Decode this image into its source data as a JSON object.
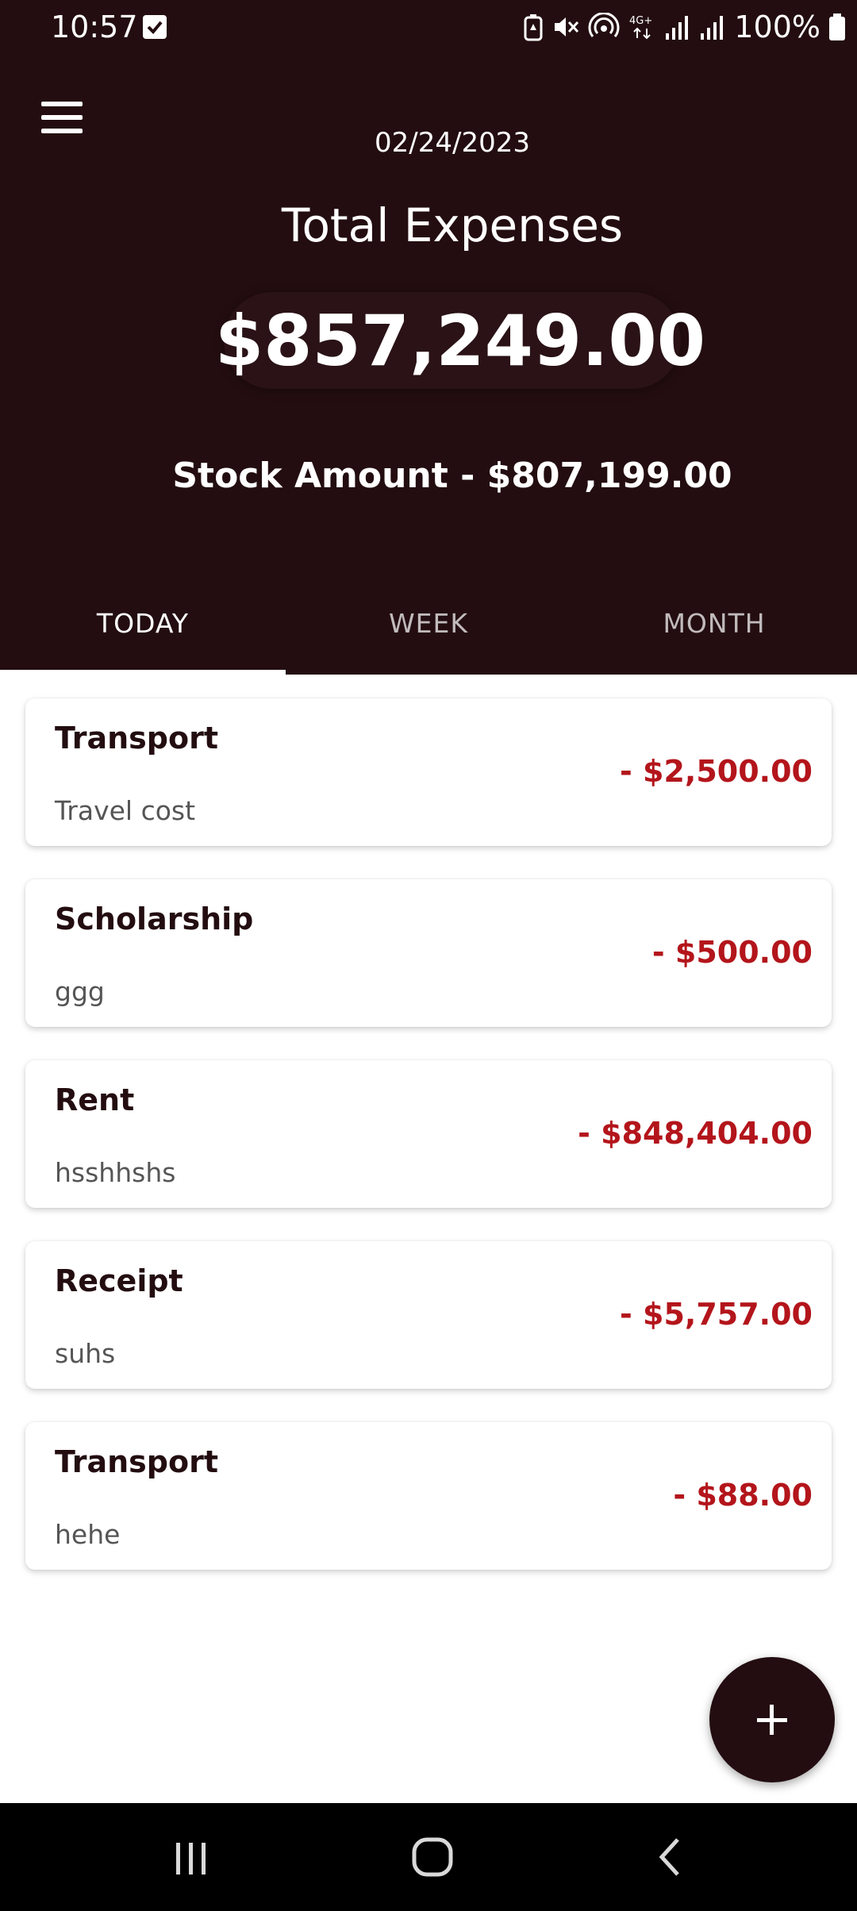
{
  "status_bar": {
    "time": "10:57",
    "battery": "100%",
    "network": "4G+"
  },
  "header": {
    "date": "02/24/2023",
    "title": "Total Expenses",
    "total_amount": "$857,249.00",
    "stock_amount": "Stock Amount - $807,199.00",
    "background_color": "#230d10"
  },
  "tabs": [
    {
      "label": "TODAY",
      "active": true
    },
    {
      "label": "WEEK",
      "active": false
    },
    {
      "label": "MONTH",
      "active": false
    }
  ],
  "expenses": [
    {
      "category": "Transport",
      "description": "Travel cost",
      "amount": "- $2,500.00"
    },
    {
      "category": "Scholarship",
      "description": "ggg",
      "amount": "- $500.00"
    },
    {
      "category": "Rent",
      "description": "hsshhshs",
      "amount": "- $848,404.00"
    },
    {
      "category": "Receipt",
      "description": "suhs",
      "amount": "- $5,757.00"
    },
    {
      "category": "Transport",
      "description": "hehe",
      "amount": "- $88.00"
    }
  ],
  "colors": {
    "amount_negative": "#b3151b",
    "accent": "#230d10"
  },
  "icons": {
    "menu": "hamburger-menu-icon",
    "fab": "plus-icon",
    "nav_recent": "recent-apps-icon",
    "nav_home": "home-icon",
    "nav_back": "back-icon"
  }
}
